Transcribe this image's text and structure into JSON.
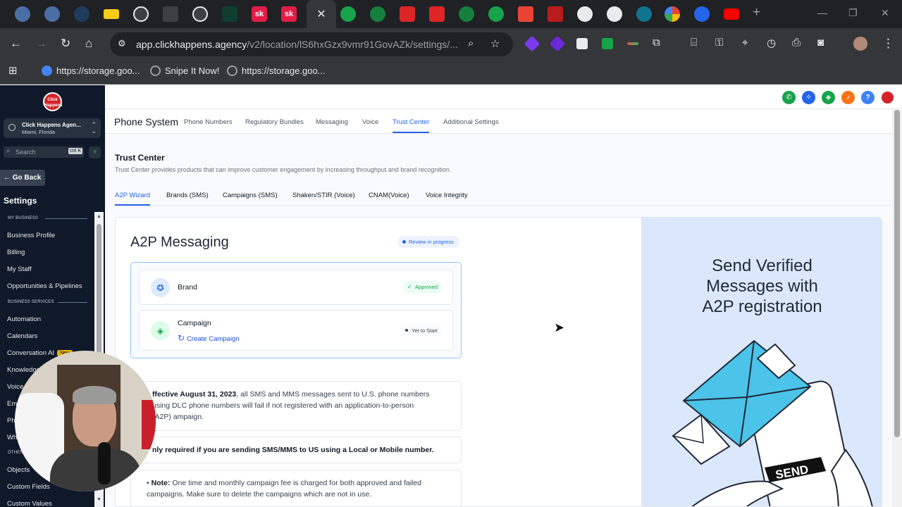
{
  "browser": {
    "url_host": "app.clickhappens.agency",
    "url_path": "/v2/location/lS6hxGzx9vmr91GovAZk/settings/...",
    "bookmarks": [
      {
        "label": "https://storage.goo..."
      },
      {
        "label": "Snipe It Now!"
      },
      {
        "label": "https://storage.goo..."
      }
    ],
    "tab_labels": [
      "sk",
      "sk"
    ]
  },
  "sidebar": {
    "logo_text": "Click Happens",
    "account_name": "Click Happens Agen...",
    "account_location": "Miami, Florida",
    "search_placeholder": "Search",
    "search_shortcut": "ctrl K",
    "go_back": "Go Back",
    "title": "Settings",
    "sections": {
      "my_business": "MY BUSINESS",
      "business_services": "BUSINESS SERVICES",
      "other": "OTHER"
    },
    "items": {
      "business_profile": "Business Profile",
      "billing": "Billing",
      "my_staff": "My Staff",
      "opportunities": "Opportunities & Pipelines",
      "automation": "Automation",
      "calendars": "Calendars",
      "conversation_ai": "Conversation AI",
      "conversation_ai_badge": "New",
      "knowledge": "Knowledge",
      "voice": "Voice",
      "email": "Ema",
      "phone": "Pho",
      "whatsapp": "Wha",
      "objects": "Objects",
      "custom_fields": "Custom Fields",
      "custom_values": "Custom Values"
    }
  },
  "topbar": {
    "help_label": "?"
  },
  "subnav": {
    "title": "Phone System",
    "items": [
      "Phone Numbers",
      "Regulatory Bundles",
      "Messaging",
      "Voice",
      "Trust Center",
      "Additional Settings"
    ],
    "active": "Trust Center"
  },
  "trust_center": {
    "title": "Trust Center",
    "description": "Trust Center provides products that can improve customer engagement by increasing throughput and brand recognition.",
    "tabs": [
      "A2P Wizard",
      "Brands (SMS)",
      "Campaigns (SMS)",
      "Shaken/STIR (Voice)",
      "CNAM(Voice)",
      "Voice Integrity"
    ],
    "active_tab": "A2P Wizard"
  },
  "a2p": {
    "title": "A2P Messaging",
    "status": "Review in progress",
    "brand": {
      "label": "Brand",
      "status": "Approved"
    },
    "campaign": {
      "label": "Campaign",
      "status": "Yet to Start",
      "action": "Create Campaign"
    },
    "notice_1_bold": "ffective August 31, 2023",
    "notice_1_text": ", all SMS and MMS messages sent to U.S. phone numbers using DLC phone numbers will fail if not registered with an application-to-person (A2P) ampaign.",
    "notice_2": "nly required if you are sending SMS/MMS to US using a Local or Mobile number.",
    "notice_3_bold": "Note:",
    "notice_3_text": " One time and monthly campaign fee is charged for both approved and failed campaigns. Make sure to delete the campaigns which are not in use."
  },
  "promo": {
    "title": "Send Verified Messages with A2P registration",
    "send_label": "SEND"
  },
  "colors": {
    "accent": "#2563eb",
    "sidebar_bg": "#0f1929",
    "approved": "#16a34a",
    "promo_bg": "#dbe8fb",
    "envelope": "#4cc3e8"
  }
}
